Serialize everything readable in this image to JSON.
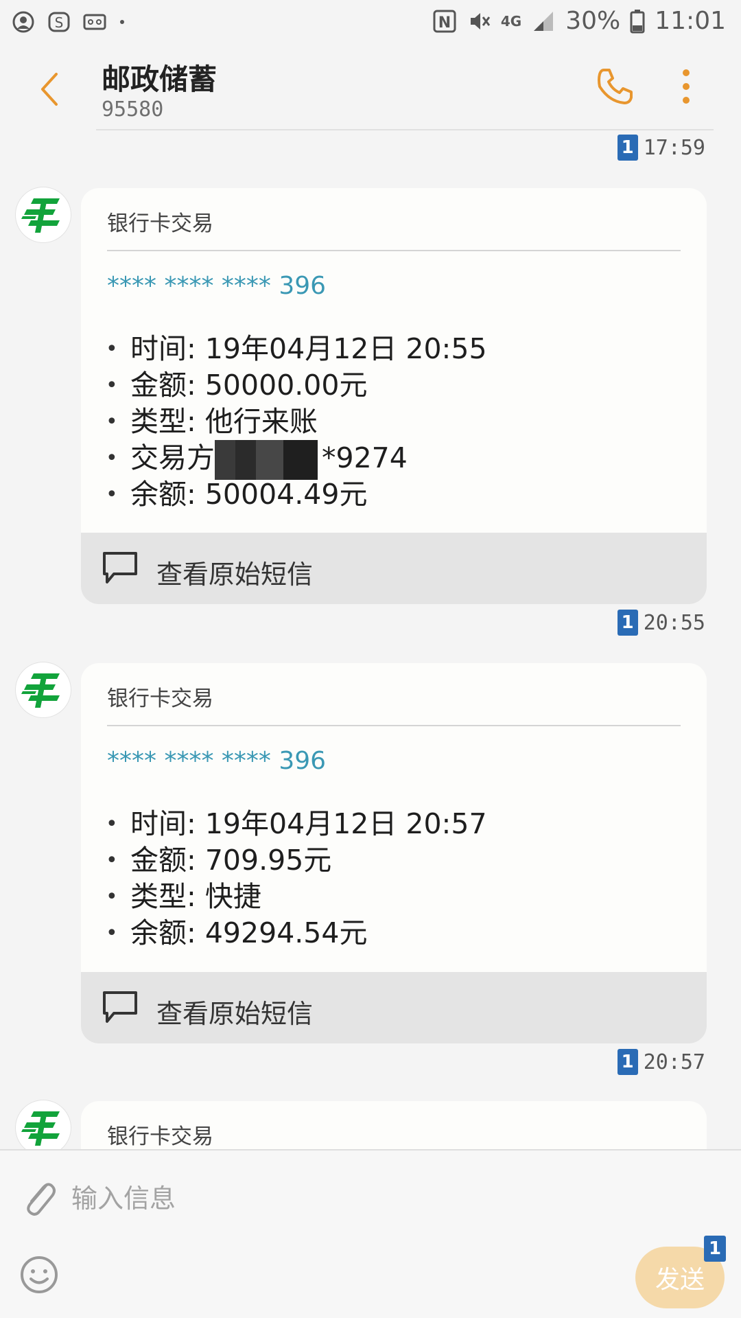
{
  "status_bar": {
    "battery": "30%",
    "time": "11:01",
    "network": "4G",
    "left_icons": [
      "account-icon",
      "s-app-icon",
      "voicemail-icon",
      "dot-icon"
    ],
    "right_icons": [
      "nfc-icon",
      "mute-icon",
      "signal-icon",
      "battery-icon"
    ]
  },
  "header": {
    "title": "邮政储蓄",
    "number": "95580"
  },
  "messages": [
    {
      "sent_time": "17:59",
      "sim": "1",
      "card_label": "银行卡交易",
      "account": "**** **** **** 396",
      "items": [
        {
          "text": "时间: 19年04月12日 20:55"
        },
        {
          "text": "金额: 50000.00元"
        },
        {
          "text": "类型: 他行来账"
        },
        {
          "prefix": "交易方",
          "suffix": "*9274"
        },
        {
          "text": "余额: 50004.49元"
        }
      ],
      "footer": "查看原始短信"
    },
    {
      "sent_time": "20:55",
      "sim": "1",
      "card_label": "银行卡交易",
      "account": "**** **** **** 396",
      "items": [
        {
          "text": "时间: 19年04月12日 20:57"
        },
        {
          "text": "金额: 709.95元"
        },
        {
          "text": "类型: 快捷"
        },
        {
          "text": "余额: 49294.54元"
        }
      ],
      "footer": "查看原始短信"
    },
    {
      "sent_time": "20:57",
      "sim": "1",
      "card_label": "银行卡交易"
    }
  ],
  "composer": {
    "placeholder": "输入信息",
    "send_label": "发送",
    "send_sim": "1"
  },
  "colors": {
    "accent": "#e8962e",
    "link": "#3a98b4",
    "sim_badge": "#2a6bb5",
    "logo_green": "#12a33b"
  }
}
